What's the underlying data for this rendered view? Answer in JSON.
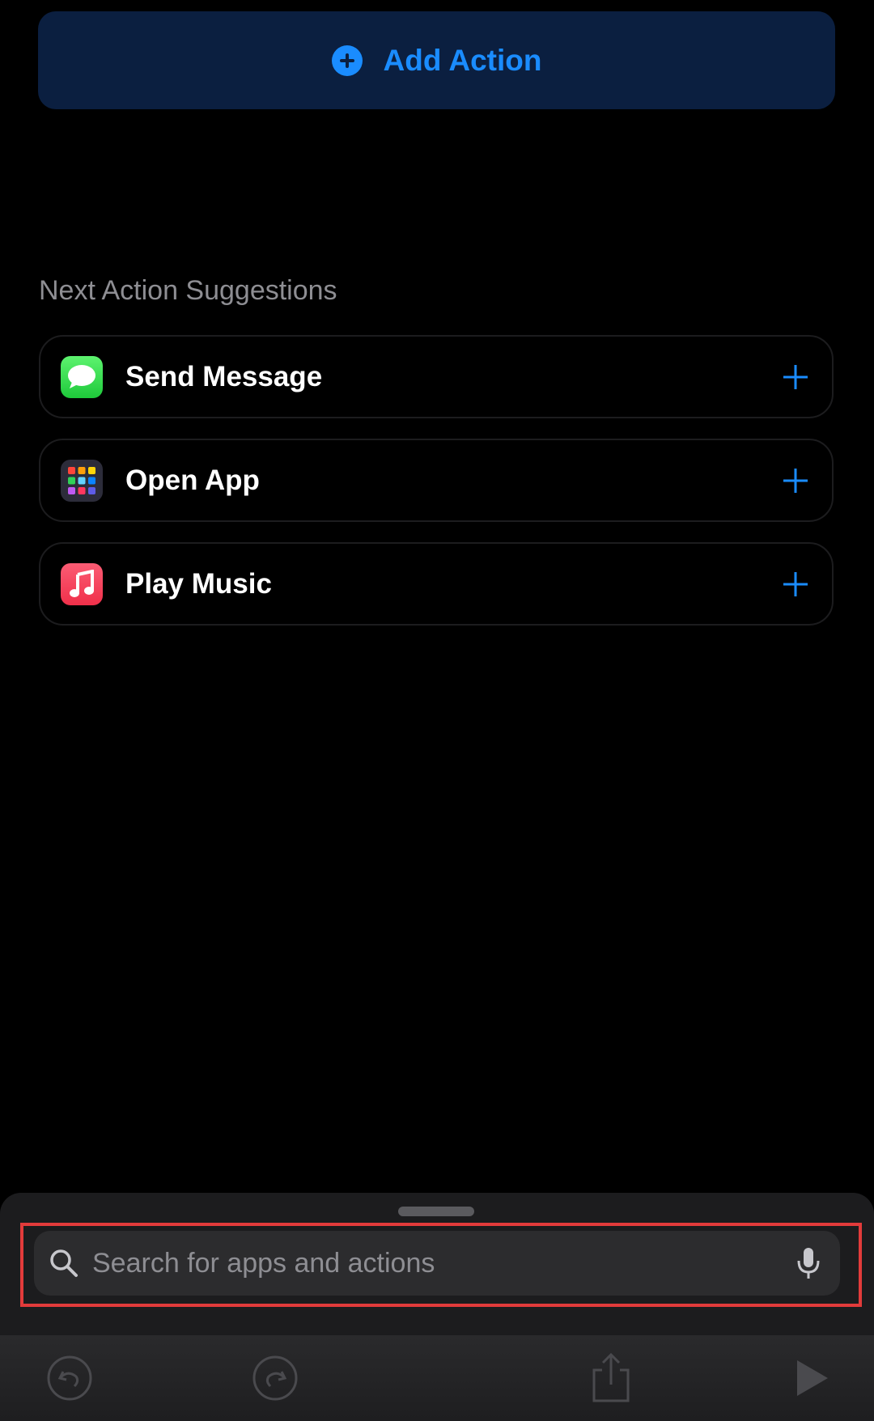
{
  "add_action": {
    "label": "Add Action"
  },
  "suggestions": {
    "title": "Next Action Suggestions",
    "items": [
      {
        "label": "Send Message",
        "icon": "messages-app-icon"
      },
      {
        "label": "Open App",
        "icon": "app-grid-icon"
      },
      {
        "label": "Play Music",
        "icon": "music-app-icon"
      }
    ]
  },
  "search": {
    "placeholder": "Search for apps and actions"
  },
  "toolbar": {
    "buttons": [
      "undo-icon",
      "redo-icon",
      "share-icon",
      "play-icon"
    ]
  },
  "colors": {
    "accent": "#1a8cff",
    "highlight": "#e23b3b",
    "background": "#000000"
  }
}
